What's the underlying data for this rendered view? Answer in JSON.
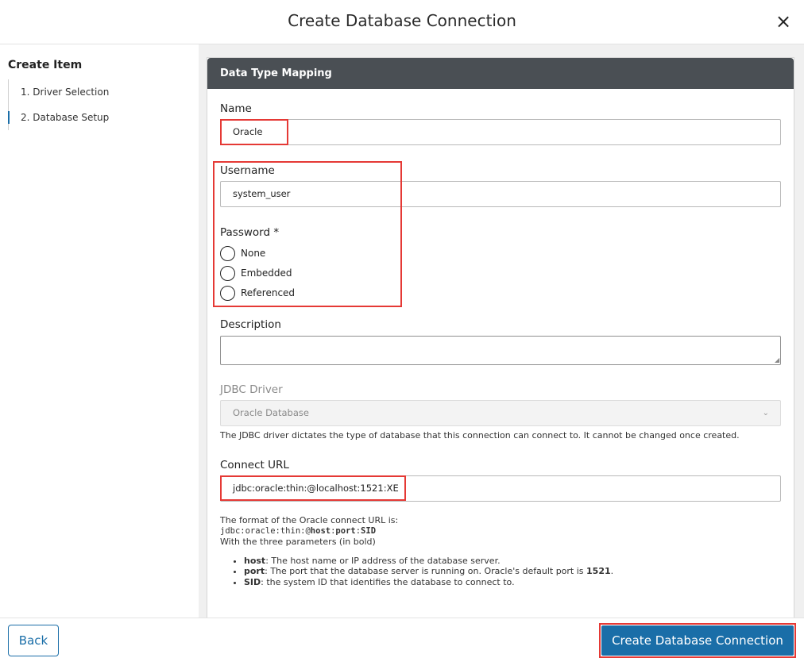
{
  "dialog": {
    "title": "Create Database Connection",
    "close_glyph": "×"
  },
  "sidebar": {
    "heading": "Create Item",
    "steps": [
      {
        "label": "1. Driver Selection",
        "active": false
      },
      {
        "label": "2. Database Setup",
        "active": true
      }
    ]
  },
  "card": {
    "title": "Data Type Mapping"
  },
  "form": {
    "name_label": "Name",
    "name_value": "Oracle",
    "username_label": "Username",
    "username_value": "system_user",
    "password_label": "Password *",
    "password_options": [
      "None",
      "Embedded",
      "Referenced"
    ],
    "description_label": "Description",
    "description_value": "",
    "jdbc_label": "JDBC Driver",
    "jdbc_value": "Oracle Database",
    "jdbc_hint": "The JDBC driver dictates the type of database that this connection can connect to. It cannot be changed once created.",
    "url_label": "Connect URL",
    "url_value": "jdbc:oracle:thin:@localhost:1521:XE"
  },
  "help": {
    "intro": "The format of the Oracle connect URL is:",
    "format_prefix": "jdbc:oracle:thin:@",
    "format_host": "host",
    "format_sep1": ":",
    "format_port": "port",
    "format_sep2": ":",
    "format_sid": "SID",
    "params_line": "With the three parameters (in bold)",
    "host_term": "host",
    "host_desc": ": The host name or IP address of the database server.",
    "port_term": "port",
    "port_desc": ": The port that the database server is running on. Oracle's default port is ",
    "port_default": "1521",
    "port_end": ".",
    "sid_term": "SID",
    "sid_desc": ": the system ID that identifies the database to connect to."
  },
  "footer": {
    "back_label": "Back",
    "create_label": "Create Database Connection"
  },
  "colors": {
    "accent": "#1a6ea8",
    "highlight": "#e53935",
    "header_bg": "#4a4f54"
  }
}
